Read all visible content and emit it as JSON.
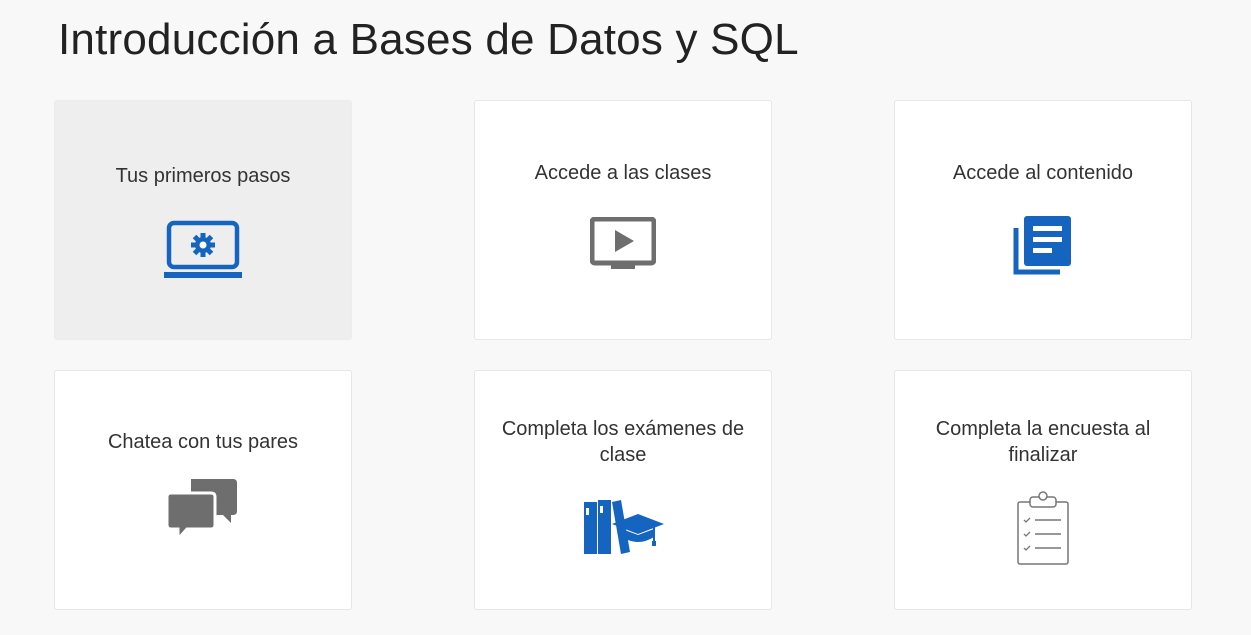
{
  "page": {
    "title": "Introducción a Bases de Datos y SQL"
  },
  "colors": {
    "blue": "#1565c0",
    "gray": "#6e6e6e",
    "active_bg": "#eeeeee"
  },
  "cards": [
    {
      "label": "Tus primeros pasos",
      "icon": "laptop-gear-icon",
      "active": true
    },
    {
      "label": "Accede a las clases",
      "icon": "video-play-icon",
      "active": false
    },
    {
      "label": "Accede al contenido",
      "icon": "document-stack-icon",
      "active": false
    },
    {
      "label": "Chatea con tus pares",
      "icon": "chat-bubbles-icon",
      "active": false
    },
    {
      "label": "Completa los exámenes de clase",
      "icon": "books-graduation-cap-icon",
      "active": false
    },
    {
      "label": "Completa la encuesta al finalizar",
      "icon": "clipboard-checklist-icon",
      "active": false
    }
  ]
}
